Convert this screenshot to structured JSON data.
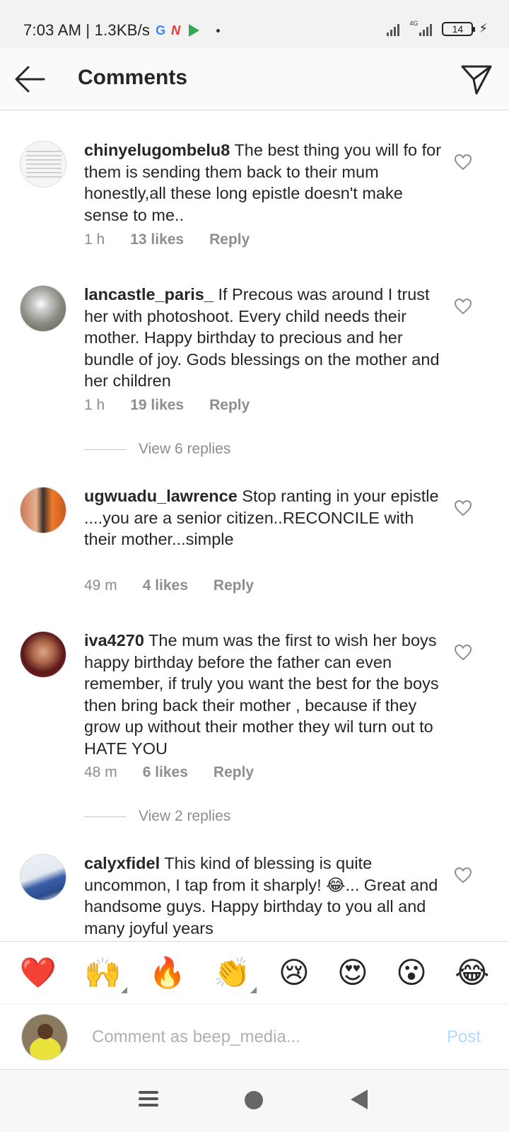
{
  "status_bar": {
    "time": "7:03 AM | 1.3KB/s",
    "net_type": "4G",
    "battery": "14",
    "icons": [
      "google-icon",
      "news-icon",
      "play-store-icon"
    ]
  },
  "header": {
    "title": "Comments",
    "back_icon": "arrow-left-icon",
    "share_icon": "paper-plane-icon"
  },
  "comments": [
    {
      "username": "chinyelugombelu8",
      "text": "The best thing you will fo for them is sending them back to their mum honestly,all these long epistle doesn't make sense to me..",
      "time": "1 h",
      "likes": "13 likes",
      "reply": "Reply"
    },
    {
      "username": "lancastle_paris_",
      "text": "If Precous was around I trust her with photoshoot. Every child needs their mother. Happy birthday to precious and her bundle of joy. Gods blessings on the mother and her children",
      "time": "1 h",
      "likes": "19 likes",
      "reply": "Reply",
      "view_replies": "View 6 replies"
    },
    {
      "username": "ugwuadu_lawrence",
      "text": "Stop ranting in your epistle ....you are a senior citizen..RECONCILE with their mother...simple",
      "time": "49 m",
      "likes": "4 likes",
      "reply": "Reply"
    },
    {
      "username": "iva4270",
      "text": "The mum was the first to wish her boys happy birthday before the father can even remember, if truly you want the best for the boys then bring back their mother , because if they grow up without their mother they wil turn out to HATE YOU",
      "time": "48 m",
      "likes": "6 likes",
      "reply": "Reply",
      "view_replies": "View 2 replies"
    },
    {
      "username": "calyxfidel",
      "text": "This kind of blessing is quite uncommon, I tap from it sharply! 😂... Great and handsome guys. Happy birthday to you all and many joyful years"
    }
  ],
  "emoji_bar": [
    "❤️",
    "🙌",
    "🔥",
    "👏",
    "😢",
    "😍",
    "😮",
    "😂"
  ],
  "input": {
    "placeholder": "Comment as beep_media...",
    "post_label": "Post"
  },
  "colors": {
    "heart_red": "#ed4956",
    "post_disabled": "#b3dbff",
    "meta_gray": "#8e8e8e"
  }
}
